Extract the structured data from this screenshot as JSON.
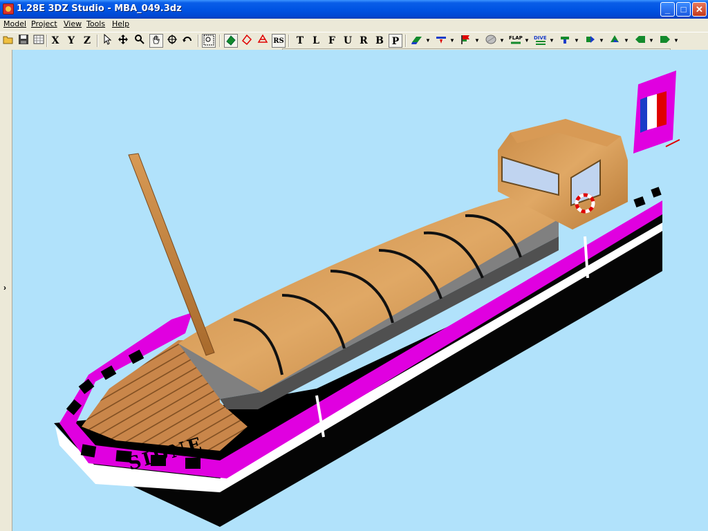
{
  "window": {
    "title": "1.28E 3DZ Studio - MBA_049.3dz",
    "icon": "app-icon",
    "controls": {
      "minimize": "_",
      "maximize": "□",
      "close": "✕"
    }
  },
  "menu": {
    "items": [
      {
        "label": "Model"
      },
      {
        "label": "Project"
      },
      {
        "label": "View"
      },
      {
        "label": "Tools"
      },
      {
        "label": "Help"
      }
    ]
  },
  "toolbar": {
    "view_letters": [
      "T",
      "L",
      "F",
      "U",
      "R",
      "B",
      "P"
    ],
    "axis_letters": [
      "X",
      "Y",
      "Z"
    ],
    "rs_label": "RS",
    "flap_label": "FLAP",
    "dive_label": "DIVE",
    "icons": {
      "open": "open-folder-icon",
      "save": "save-icon",
      "grid": "grid-icon",
      "select": "pointer-icon",
      "move": "move-icon",
      "zoom": "magnifier-icon",
      "pan": "hand-icon",
      "rotate": "rotate-icon",
      "undo": "undo-icon"
    },
    "colors": {
      "black": "#000000",
      "red": "#e00000",
      "yellow": "#f8e800",
      "green": "#138a2c",
      "blue": "#1a3cc8",
      "magenta": "#e000e0"
    }
  },
  "viewport": {
    "background": "#b1e2fb",
    "hull_name": "SIDNE",
    "flag_colors": [
      "#1a3cc8",
      "#ffffff",
      "#e00000"
    ]
  },
  "sidebar": {
    "expand_glyph": "›"
  }
}
